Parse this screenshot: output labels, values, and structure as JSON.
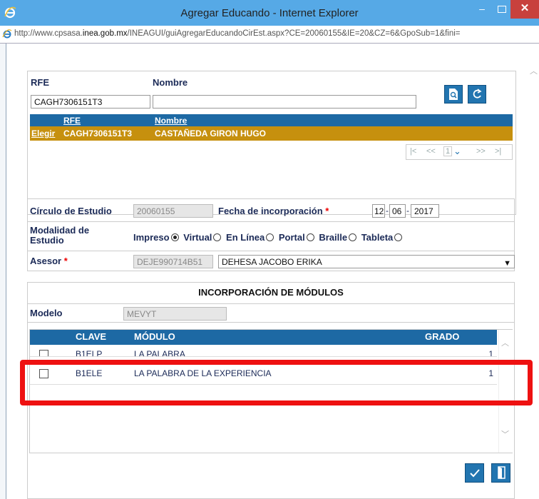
{
  "window": {
    "title": "Agregar Educando - Internet Explorer",
    "url_prefix": "http://www.cpsasa.",
    "url_domain": "inea.gob.mx",
    "url_rest": "/INEAGUI/guiAgregarEducandoCirEst.aspx?CE=20060155&IE=20&CZ=6&GpoSub=1&fini=",
    "min_glyph": "–",
    "close_glyph": "✕"
  },
  "search": {
    "rfe_label": "RFE",
    "nombre_label": "Nombre",
    "rfe_value": "CAGH7306151T3",
    "nombre_value": ""
  },
  "results": {
    "col_rfe": "RFE",
    "col_nombre": "Nombre",
    "row": {
      "action": "Elegir",
      "rfe": "CAGH7306151T3",
      "nombre": "CASTAÑEDA GIRON HUGO"
    },
    "pager": {
      "first": "|<",
      "prev": "<<",
      "page": "1",
      "next": ">>",
      "last": ">|"
    }
  },
  "form": {
    "circulo_label": "Círculo de Estudio",
    "circulo_value": "20060155",
    "fecha_label": "Fecha de incorporación",
    "required_mark": "*",
    "fecha_day": "12",
    "fecha_month": "06",
    "fecha_year": "2017",
    "date_sep": "-",
    "modalidad_label_1": "Modalidad de",
    "modalidad_label_2": "Estudio",
    "modalidades": [
      {
        "label": "Impreso",
        "selected": true
      },
      {
        "label": "Virtual",
        "selected": false
      },
      {
        "label": "En Línea",
        "selected": false
      },
      {
        "label": "Portal",
        "selected": false
      },
      {
        "label": "Braille",
        "selected": false
      },
      {
        "label": "Tableta",
        "selected": false
      }
    ],
    "asesor_label": "Asesor",
    "asesor_rfe": "DEJE990714B51",
    "asesor_nombre": "DEHESA JACOBO ERIKA"
  },
  "modulos": {
    "section_title": "INCORPORACIÓN DE MÓDULOS",
    "modelo_label": "Modelo",
    "modelo_value": "MEVYT",
    "headers": {
      "clave": "CLAVE",
      "modulo": "MÓDULO",
      "grado": "GRADO"
    },
    "rows": [
      {
        "clave": "B1ELP",
        "modulo": "LA PALABRA",
        "grado": "1"
      },
      {
        "clave": "B1ELE",
        "modulo": "LA PALABRA DE LA EXPERIENCIA",
        "grado": "1"
      }
    ]
  },
  "colors": {
    "header_blue": "#1d69a4",
    "selected_row": "#c6900e",
    "highlight_red": "#ee1111",
    "titlebar": "#56a9e6"
  }
}
